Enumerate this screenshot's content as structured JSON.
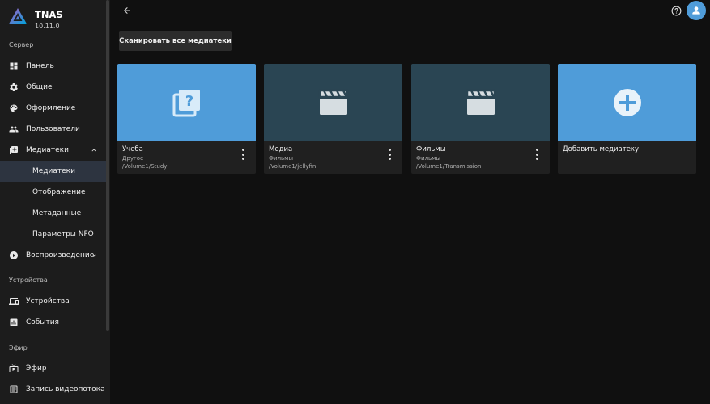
{
  "brand": {
    "title": "TNAS",
    "version": "10.11.0"
  },
  "sidebar": {
    "sections": {
      "server": "Сервер",
      "devices": "Устройства",
      "live": "Эфир"
    },
    "items": [
      {
        "label": "Панель"
      },
      {
        "label": "Общие"
      },
      {
        "label": "Оформление"
      },
      {
        "label": "Пользователи"
      },
      {
        "label": "Медиатеки"
      },
      {
        "label": "Медиатеки"
      },
      {
        "label": "Отображение"
      },
      {
        "label": "Метаданные"
      },
      {
        "label": "Параметры NFO"
      },
      {
        "label": "Воспроизведение"
      },
      {
        "label": "Устройства"
      },
      {
        "label": "События"
      },
      {
        "label": "Эфир"
      },
      {
        "label": "Запись видеопотока"
      }
    ]
  },
  "toolbar": {
    "scan_label": "Сканировать все медиатеки"
  },
  "libraries": [
    {
      "title": "Учеба",
      "type": "Другое",
      "path": "/Volume1/Study",
      "icon": "unknown-library-icon"
    },
    {
      "title": "Медиа",
      "type": "Фильмы",
      "path": "/Volume1/jellyfin",
      "icon": "movie-clapperboard-icon"
    },
    {
      "title": "Фильмы",
      "type": "Фильмы",
      "path": "/Volume1/Transmission",
      "icon": "movie-clapperboard-icon"
    },
    {
      "title": "Добавить медиатеку",
      "icon": "add-circle-icon"
    }
  ],
  "colors": {
    "accent": "#4f9cd9",
    "card_teal": "#2a4553",
    "sidebar_bg": "#1c1c1c",
    "active_bg": "#2d3440"
  }
}
